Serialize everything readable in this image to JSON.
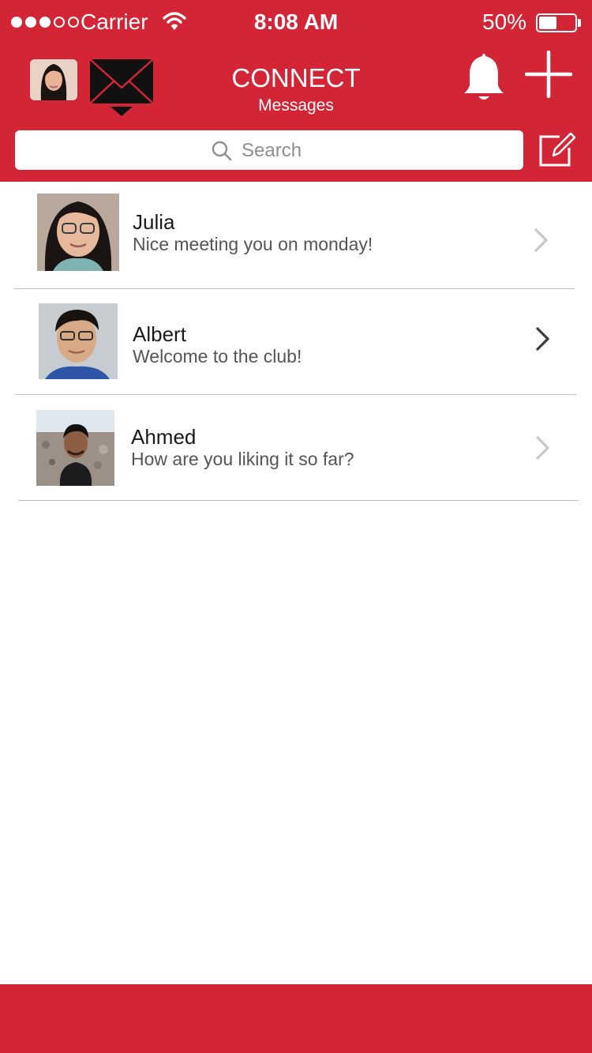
{
  "status_bar": {
    "carrier": "Carrier",
    "time": "8:08 AM",
    "battery_percent": "50%",
    "battery_level": 0.5,
    "signal_bars_filled": 3,
    "signal_bars_total": 5
  },
  "header": {
    "title": "CONNECT",
    "subtitle": "Messages",
    "icons": [
      "profile-avatar",
      "mail-icon",
      "bell-icon",
      "plus-icon",
      "compose-icon"
    ]
  },
  "search": {
    "placeholder": "Search"
  },
  "conversations": [
    {
      "name": "Julia",
      "message": "Nice meeting you on monday!"
    },
    {
      "name": "Albert",
      "message": "Welcome to the club!"
    },
    {
      "name": "Ahmed",
      "message": "How are you liking it so far?"
    }
  ],
  "colors": {
    "brand_red": "#d42536",
    "background": "#ffffff",
    "divider": "#bdbdbd"
  }
}
